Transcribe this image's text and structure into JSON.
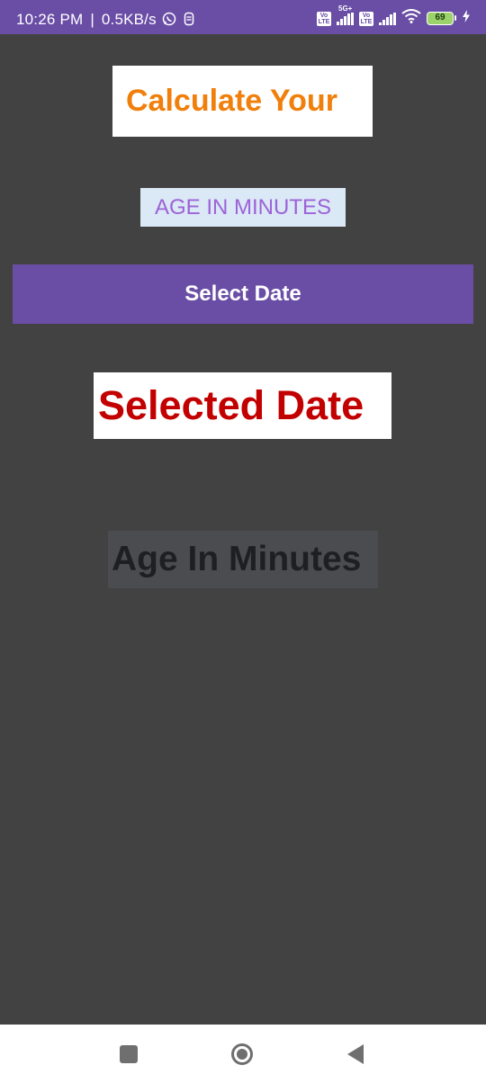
{
  "status_bar": {
    "time": "10:26 PM",
    "separator": "|",
    "speed": "0.5KB/s",
    "network_5g": "5G+",
    "volte_label": "Vo LTE",
    "battery_level": "69",
    "icons": [
      "whatsapp-icon",
      "pager-icon",
      "volte-icon",
      "signal-icon",
      "wifi-icon",
      "battery-icon",
      "charging-bolt-icon"
    ]
  },
  "main": {
    "title": "Calculate Your",
    "subtitle": "AGE IN MINUTES",
    "select_button_label": "Select Date",
    "selected_date_text": "Selected Date",
    "age_in_minutes_text": "Age In Minutes"
  },
  "nav_bar": {
    "icons": [
      "recents-square-icon",
      "home-circle-icon",
      "back-triangle-icon"
    ]
  },
  "colors": {
    "status_bar_bg": "#6a4ea6",
    "screen_bg": "#424242",
    "title_text": "#f07f0b",
    "subtitle_text": "#9c63d8",
    "subtitle_bg": "#dbe8f6",
    "button_bg": "#6a4ea6",
    "selected_date_text": "#c30000",
    "age_text": "#1d1f23"
  }
}
